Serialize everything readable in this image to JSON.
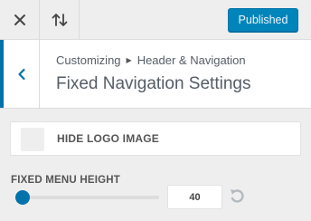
{
  "topbar": {
    "close_icon": "close-icon",
    "sort_icon": "sort-arrows-icon",
    "publish_label": "Published"
  },
  "header": {
    "back_icon": "chevron-left-icon",
    "breadcrumb_root": "Customizing",
    "breadcrumb_separator_icon": "triangle-right-icon",
    "breadcrumb_section": "Header & Navigation",
    "title": "Fixed Navigation Settings"
  },
  "options": {
    "hide_logo_label": "HIDE LOGO IMAGE",
    "hide_logo_checked": false,
    "menu_height_label": "FIXED MENU HEIGHT",
    "menu_height_value": "40",
    "menu_height_fraction": 0.0,
    "reset_icon": "undo-icon"
  },
  "colors": {
    "accent": "#0073aa",
    "publish_bg": "#0085ba",
    "background": "#eeeeee"
  }
}
